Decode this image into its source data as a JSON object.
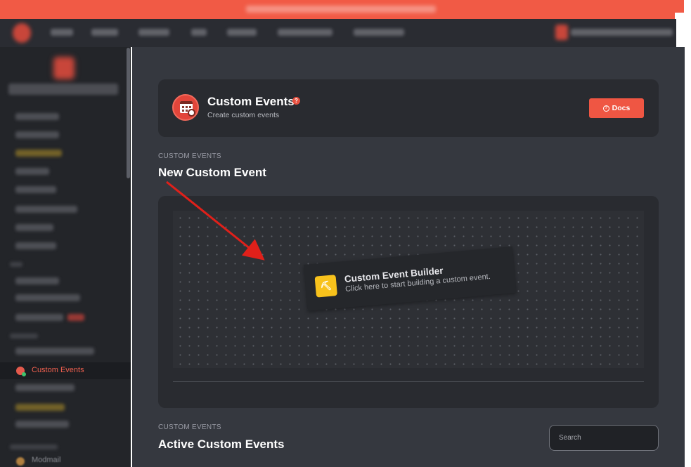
{
  "header": {
    "title": "Custom Events",
    "subtitle": "Create custom events",
    "docs_label": "Docs",
    "icon": "calendar-clock-icon"
  },
  "sidebar": {
    "active_item": "Custom Events",
    "bottom_item": "Modmail"
  },
  "new_section": {
    "label": "CUSTOM EVENTS",
    "title": "New Custom Event"
  },
  "builder_node": {
    "title": "Custom Event Builder",
    "subtitle": "Click here to start building a custom event.",
    "icon": "pickaxe-icon"
  },
  "active_section": {
    "label": "CUSTOM EVENTS",
    "title": "Active Custom Events"
  },
  "search": {
    "placeholder": "Search"
  },
  "colors": {
    "accent": "#ef5643",
    "banner": "#f15a45",
    "node_icon": "#f8c21c",
    "annotation_arrow": "#e0201a"
  }
}
